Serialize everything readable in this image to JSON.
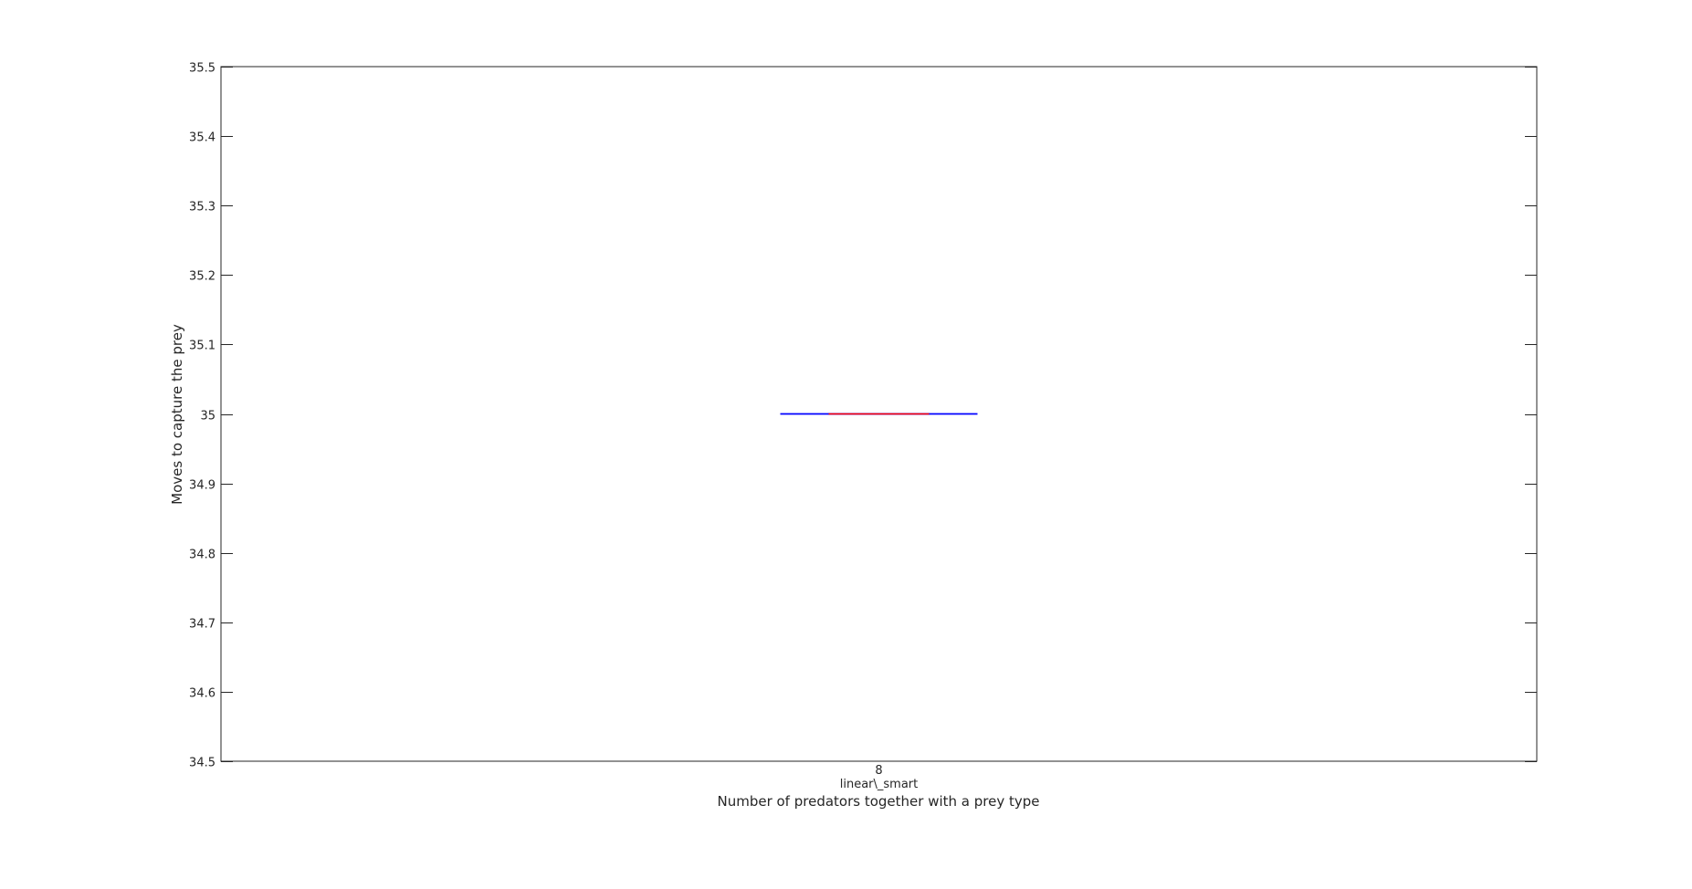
{
  "chart_data": {
    "type": "box",
    "groups": [
      {
        "number": "8",
        "prey_type": "linear\\_smart",
        "min": 35,
        "q1": 35,
        "median": 35,
        "q3": 35,
        "max": 35
      }
    ],
    "xlabel": "Number of predators together with a prey type",
    "ylabel": "Moves to capture the prey",
    "ylim": [
      34.5,
      35.5
    ],
    "yticks": [
      "34.5",
      "34.6",
      "34.7",
      "34.8",
      "34.9",
      "35",
      "35.1",
      "35.2",
      "35.3",
      "35.4",
      "35.5"
    ],
    "grid": false,
    "colors": {
      "box": "#0000ff",
      "median": "#ff0000",
      "axes": "#262626",
      "background": "#ffffff"
    }
  }
}
